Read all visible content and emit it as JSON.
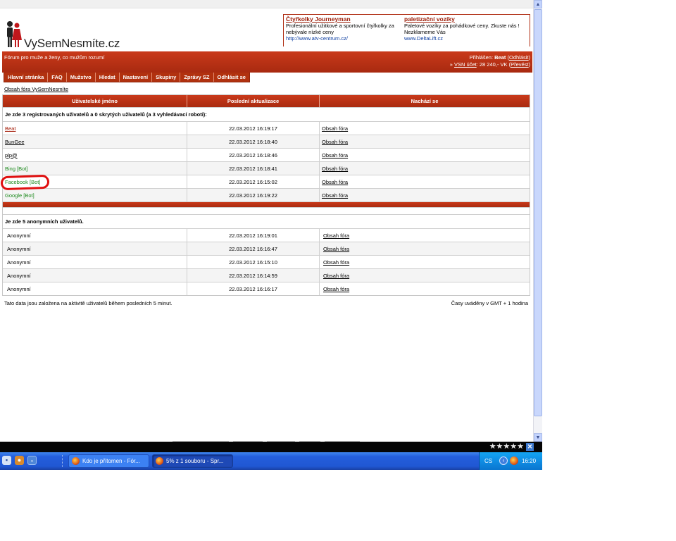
{
  "header": {
    "logo_text": "VySemNesmíte.cz",
    "tagline": "Fórum pro muže a ženy, co mužům rozumí",
    "user_prefix": "Přihlášen:",
    "username": "Beat",
    "logout_link": "Odhlásit",
    "account_prefix": "»",
    "account_link": "VSN účet",
    "account_balance": ": 28 240,- VK (",
    "transfer_link": "Převést",
    "account_suffix": ")"
  },
  "ads": [
    {
      "title": "Čtyřkolky Journeyman",
      "text": "Profesionální užitkové a sportovní čtyřkolky za nebývale nízké ceny",
      "url": "http://www.atv-centrum.cz/"
    },
    {
      "title": "paletizační vozíky",
      "text": "Paletové vozíky za pohádkové ceny. Zkuste nás ! Nezklameme Vás",
      "url": "www.DeltaLift.cz"
    }
  ],
  "nav": [
    "Hlavní stránka",
    "FAQ",
    "Mužstvo",
    "Hledat",
    "Nastavení",
    "Skupiny",
    "Zprávy SZ",
    "Odhlásit se"
  ],
  "breadcrumb": "Obsah fóra VySemNesmíte",
  "table": {
    "headers": [
      "Uživatelské jméno",
      "Poslední aktualizace",
      "Nachází se"
    ],
    "registered_heading": "Je zde 3 registrovaných uživatelů a 0 skrytých uživatelů (a 3 vyhledávací roboti):",
    "registered": [
      {
        "name": "Beat",
        "time": "22.03.2012 16:19:17",
        "location": "Obsah fóra"
      },
      {
        "name": "BunGee",
        "time": "22.03.2012 16:18:40",
        "location": "Obsah fóra"
      },
      {
        "name": "plp@",
        "time": "22.03.2012 16:18:46",
        "location": "Obsah fóra"
      },
      {
        "name": "Bing [Bot]",
        "time": "22.03.2012 16:18:41",
        "location": "Obsah fóra"
      },
      {
        "name": "Facebook [Bot]",
        "time": "22.03.2012 16:15:02",
        "location": "Obsah fóra"
      },
      {
        "name": "Google [Bot]",
        "time": "22.03.2012 16:19:22",
        "location": "Obsah fóra"
      }
    ],
    "anonymous_heading": "Je zde 5 anonymních uživatelů.",
    "anonymous": [
      {
        "name": "Anonymní",
        "time": "22.03.2012 16:19:01",
        "location": "Obsah fóra"
      },
      {
        "name": "Anonymní",
        "time": "22.03.2012 16:16:47",
        "location": "Obsah fóra"
      },
      {
        "name": "Anonymní",
        "time": "22.03.2012 16:15:10",
        "location": "Obsah fóra"
      },
      {
        "name": "Anonymní",
        "time": "22.03.2012 16:14:59",
        "location": "Obsah fóra"
      },
      {
        "name": "Anonymní",
        "time": "22.03.2012 16:16:17",
        "location": "Obsah fóra"
      }
    ]
  },
  "footer": {
    "note": "Tato data jsou založena na aktivitě uživatelů během posledních 5 minut.",
    "timezone": "Časy uváděny v GMT + 1 hodina"
  },
  "rating_stars": "★★★★★",
  "taskbar": {
    "tasks": [
      "Kdo je přítomen - Fór...",
      "5% z 1 souboru - Spr..."
    ],
    "language": "CS",
    "clock": "16:20"
  },
  "colors": {
    "brand_red": "#b1310f",
    "bot_green": "#1e8a1e",
    "highlight": "#e01010"
  }
}
